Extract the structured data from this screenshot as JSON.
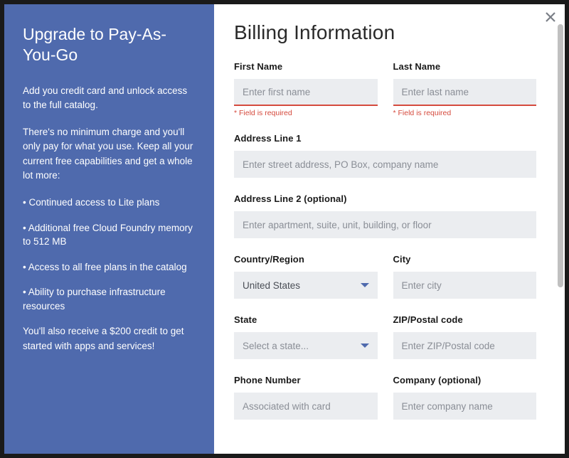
{
  "sidebar": {
    "title": "Upgrade to Pay-As-You-Go",
    "intro": "Add you credit card and unlock access to the full catalog.",
    "para2": "There's no minimum charge and you'll only pay for what you use. Keep all your current free capabilities and get a whole lot more:",
    "bullets": [
      "Continued access to Lite plans",
      "Additional free Cloud Foundry memory to 512 MB",
      "Access to all free plans in the catalog",
      "Ability to purchase infrastructure resources"
    ],
    "outro": "You'll also receive a $200 credit to get started with apps and services!"
  },
  "form": {
    "heading": "Billing Information",
    "first_name": {
      "label": "First Name",
      "placeholder": "Enter first name",
      "error": "Field is required"
    },
    "last_name": {
      "label": "Last Name",
      "placeholder": "Enter last name",
      "error": "Field is required"
    },
    "addr1": {
      "label": "Address Line 1",
      "placeholder": "Enter street address, PO Box, company name"
    },
    "addr2": {
      "label": "Address Line 2 (optional)",
      "placeholder": "Enter apartment, suite, unit, building, or floor"
    },
    "country": {
      "label": "Country/Region",
      "value": "United States"
    },
    "city": {
      "label": "City",
      "placeholder": "Enter city"
    },
    "state": {
      "label": "State",
      "placeholder": "Select a state..."
    },
    "zip": {
      "label": "ZIP/Postal code",
      "placeholder": "Enter ZIP/Postal code"
    },
    "phone": {
      "label": "Phone Number",
      "placeholder": "Associated with card"
    },
    "company": {
      "label": "Company (optional)",
      "placeholder": "Enter company name"
    }
  }
}
